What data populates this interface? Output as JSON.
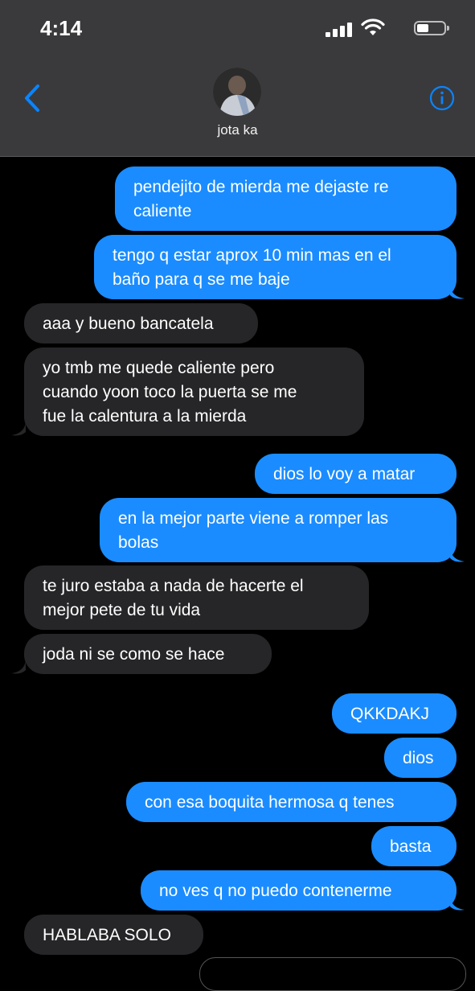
{
  "status_bar": {
    "time": "4:14"
  },
  "header": {
    "contact_name": "jota ka"
  },
  "colors": {
    "sent": "#1a8cff",
    "received": "#262628",
    "accent": "#0a84ff",
    "header_bg": "#3a3a3c"
  },
  "icons": [
    "back-chevron-icon",
    "info-icon",
    "signal-icon",
    "wifi-icon",
    "battery-icon"
  ],
  "messages": [
    {
      "side": "sent",
      "text": "pendejito de mierda me dejaste re\ncaliente"
    },
    {
      "side": "sent",
      "text": "tengo q estar aprox 10 min mas en el\nbaño para q se me baje"
    },
    {
      "side": "received",
      "text": "aaa y bueno bancatela"
    },
    {
      "side": "received",
      "text": "yo tmb me quede caliente pero\ncuando yoon toco la puerta se me\nfue la calentura a la mierda"
    },
    {
      "side": "sent",
      "text": "dios lo voy a matar"
    },
    {
      "side": "sent",
      "text": "en la mejor parte viene a romper las\nbolas"
    },
    {
      "side": "received",
      "text": "te juro estaba a nada de hacerte el\nmejor pete de tu vida"
    },
    {
      "side": "received",
      "text": "joda ni se como se hace"
    },
    {
      "side": "sent",
      "text": "QKKDAKJ"
    },
    {
      "side": "sent",
      "text": "dios"
    },
    {
      "side": "sent",
      "text": "con esa boquita hermosa q tenes"
    },
    {
      "side": "sent",
      "text": "basta"
    },
    {
      "side": "sent",
      "text": "no ves q no puedo contenerme"
    },
    {
      "side": "received",
      "text": "HABLABA SOLO"
    }
  ]
}
